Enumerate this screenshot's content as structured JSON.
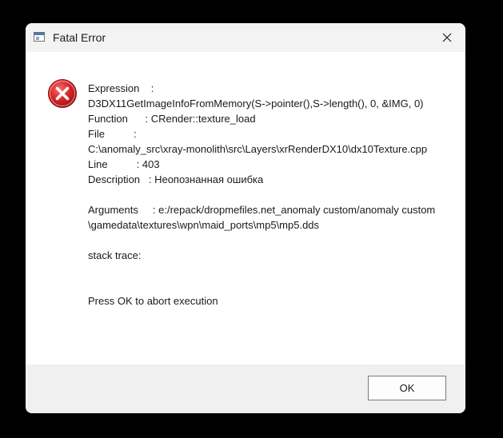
{
  "window": {
    "title": "Fatal Error",
    "icon": "app-window-icon",
    "close_icon": "close-icon"
  },
  "message": {
    "icon": "error-icon",
    "expression_label": "Expression    :",
    "expression_value": "D3DX11GetImageInfoFromMemory(S->pointer(),S->length(), 0, &IMG, 0)",
    "function_line": "Function      : CRender::texture_load",
    "file_label": "File          :",
    "file_value": "C:\\anomaly_src\\xray-monolith\\src\\Layers\\xrRenderDX10\\dx10Texture.cpp",
    "line_line": "Line          : 403",
    "description_line": "Description   : Неопознанная ошибка",
    "arguments_line": "Arguments     : e:/repack/dropmefiles.net_anomaly custom/anomaly custom\\gamedata\\textures\\wpn\\maid_ports\\mp5\\mp5.dds",
    "stack_trace": "stack trace:",
    "abort_prompt": "Press OK to abort execution"
  },
  "buttons": {
    "ok_label": "OK"
  },
  "colors": {
    "screen_background": "#000000",
    "titlebar": "#f3f3f3",
    "dialog_body": "#ffffff",
    "footer": "#f0f0f0",
    "error_red": "#d32f2f",
    "text": "#1a1a1a"
  }
}
